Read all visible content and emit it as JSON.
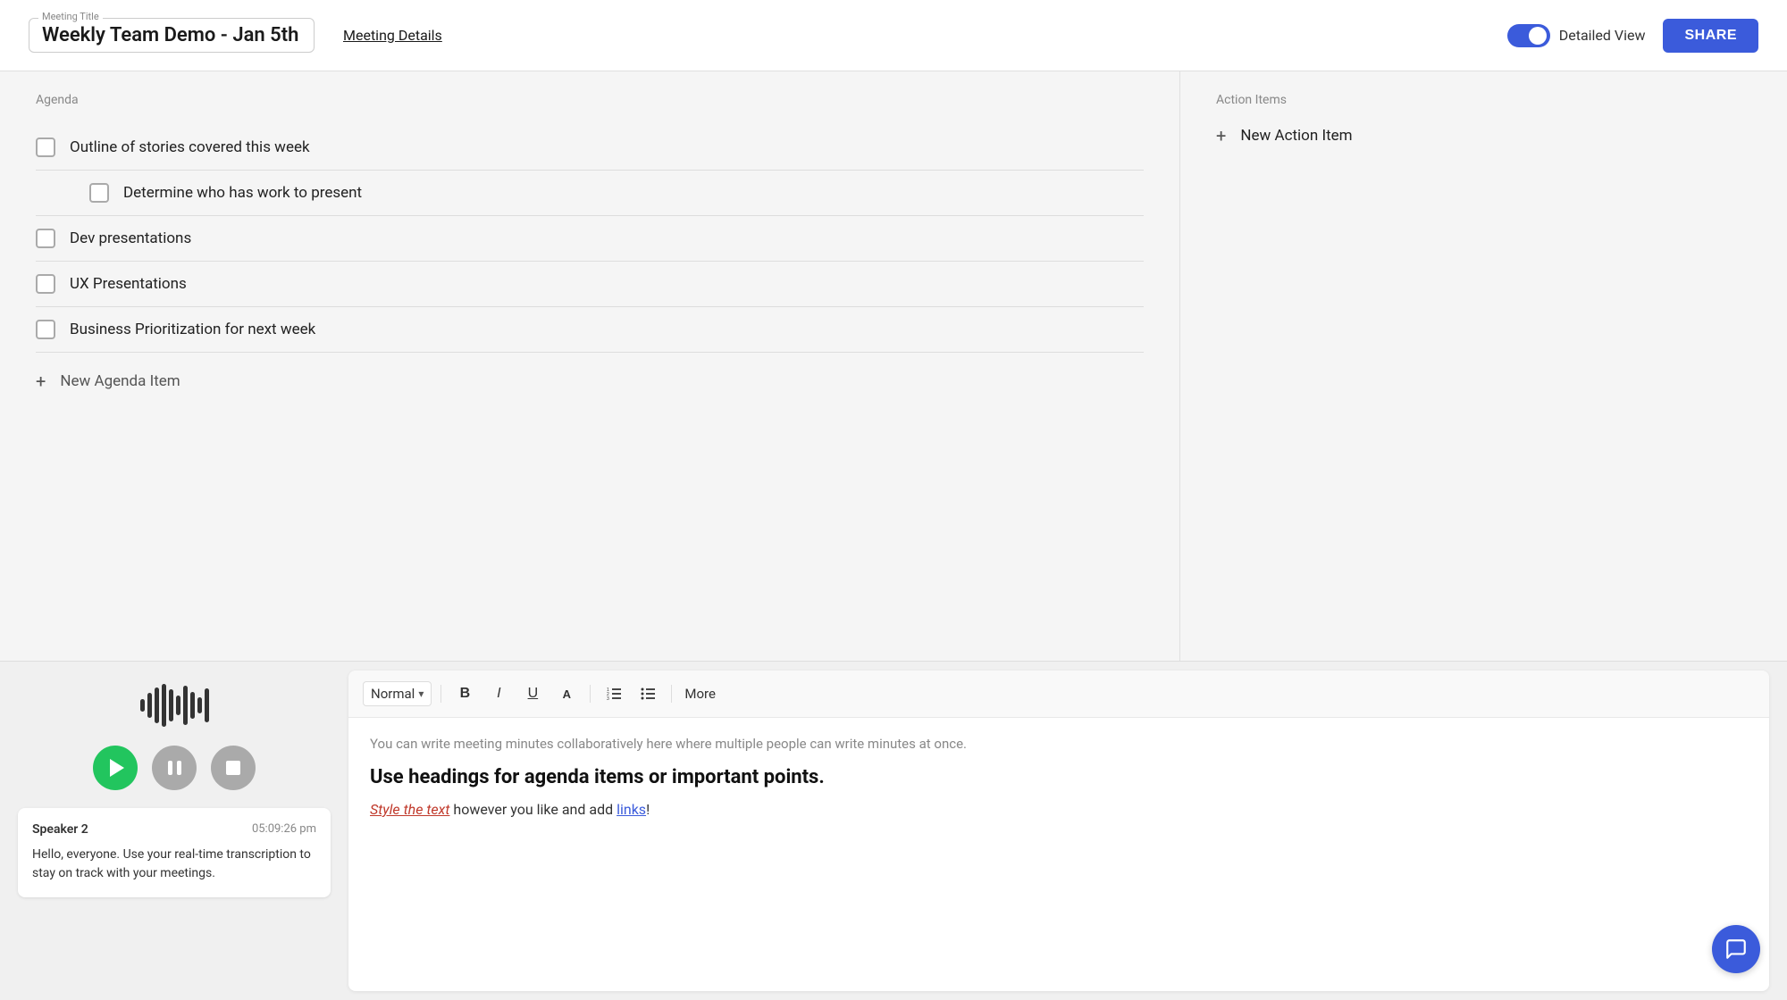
{
  "header": {
    "meeting_title_label": "Meeting Title",
    "meeting_title": "Weekly Team Demo - Jan 5th",
    "meeting_details_link": "Meeting Details",
    "detailed_view_label": "Detailed View",
    "share_button_label": "SHARE"
  },
  "agenda": {
    "section_label": "Agenda",
    "items": [
      {
        "id": 1,
        "text": "Outline of stories covered this week",
        "sub": false
      },
      {
        "id": 2,
        "text": "Determine who has work to present",
        "sub": true
      },
      {
        "id": 3,
        "text": "Dev presentations",
        "sub": false
      },
      {
        "id": 4,
        "text": "UX Presentations",
        "sub": false
      },
      {
        "id": 5,
        "text": "Business Prioritization for next week",
        "sub": false
      }
    ],
    "new_item_label": "New Agenda Item"
  },
  "action_items": {
    "section_label": "Action Items",
    "new_item_label": "New Action Item"
  },
  "transcription": {
    "speaker": "Speaker 2",
    "time": "05:09:26 pm",
    "text": "Hello, everyone. Use your real-time transcription to stay on track with your meetings."
  },
  "toolbar": {
    "format_label": "Normal",
    "bold_label": "B",
    "italic_label": "I",
    "underline_label": "U",
    "more_label": "More"
  },
  "editor": {
    "hint": "You can write meeting minutes collaboratively here where multiple people can write minutes at once.",
    "heading": "Use headings for agenda items or important points.",
    "styled_text": "Style the text",
    "plain_text": " however you like and add ",
    "link_text": "links",
    "end_text": "!"
  }
}
